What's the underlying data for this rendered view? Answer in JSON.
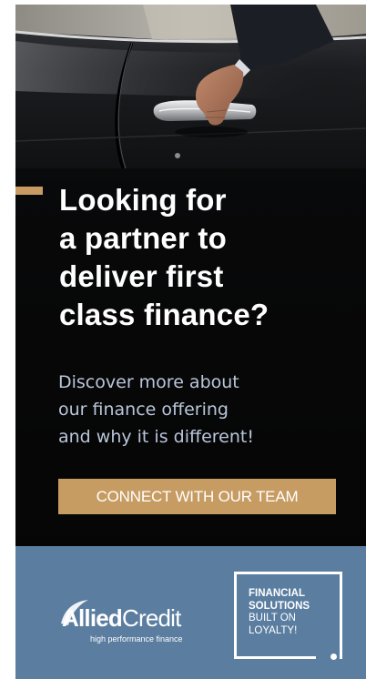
{
  "headline": {
    "lines": [
      "Looking for",
      "a partner to",
      "deliver first",
      "class finance?"
    ]
  },
  "subtext": {
    "lines": [
      "Discover more about",
      "our finance offering",
      "and why it is different!"
    ]
  },
  "cta": {
    "label": "CONNECT WITH OUR TEAM"
  },
  "logo": {
    "name_part1": "Allied",
    "name_part2": "Credit",
    "tagline": "high performance finance"
  },
  "badge": {
    "line1": "FINANCIAL",
    "line2": "SOLUTIONS",
    "line3": "BUILT ON",
    "line4": "LOYALTY!"
  },
  "colors": {
    "accent_gold": "#c79c63",
    "footer_blue": "#5a7da0",
    "subtext_blue": "#b9c6da",
    "hero_dark": "#0b0c0e"
  }
}
